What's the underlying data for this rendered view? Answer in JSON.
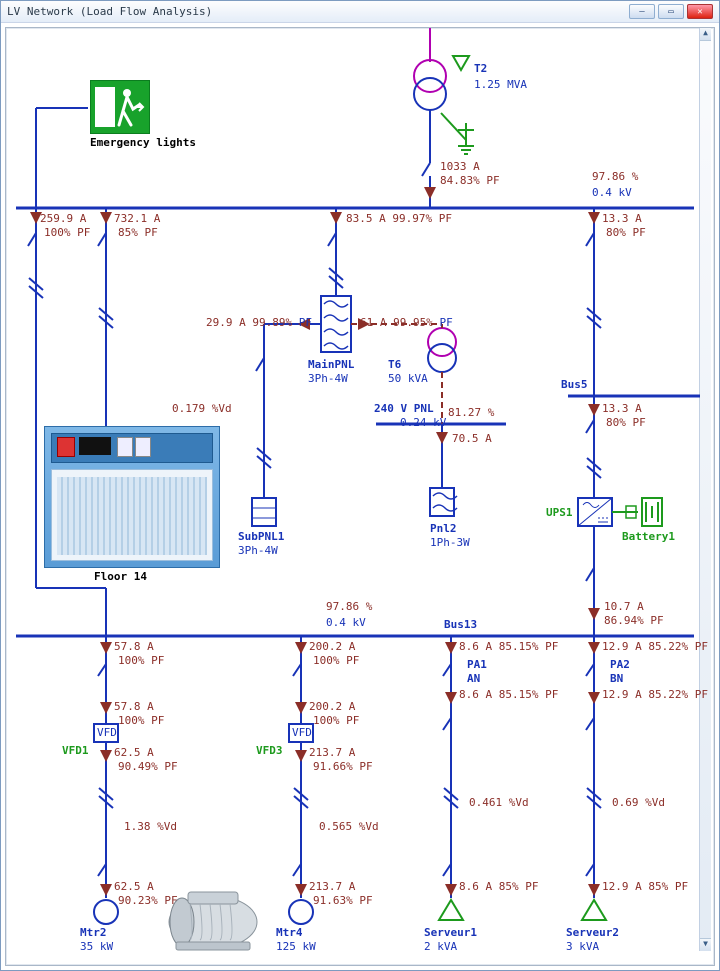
{
  "window": {
    "title": "LV Network (Load Flow Analysis)"
  },
  "labels": {
    "emergency": "Emergency lights",
    "floor14": "Floor 14"
  },
  "source": {
    "T2": {
      "name": "T2",
      "rating": "1.25 MVA"
    }
  },
  "busMain": {
    "voltPct": "97.86 %",
    "voltage": "0.4 kV",
    "incoming": {
      "amps": "1033 A",
      "pf": "84.83% PF"
    }
  },
  "feedersTop": {
    "f1": {
      "amps": "259.9 A",
      "pf": "100% PF",
      "vdrop": "0.179 %Vd"
    },
    "f2": {
      "amps": "732.1 A",
      "pf": "85% PF"
    },
    "f3": {
      "amps": "83.5 A",
      "pf": "99.97% PF"
    },
    "f4": {
      "amps": "13.3 A",
      "pf": "80% PF"
    }
  },
  "panelGroup": {
    "mainpnl": {
      "name": "MainPNL",
      "type": "3Ph-4W",
      "amps": "29.9 A 99.89%",
      "pfWord": "PF"
    },
    "subpnl1": {
      "name": "SubPNL1",
      "type": "3Ph-4W"
    },
    "t6branch": {
      "amps": "61 A 99.95%",
      "pfWord": "PF"
    },
    "T6": {
      "name": "T6",
      "rating": "50 kVA"
    },
    "pnl240": {
      "name": "240 V PNL",
      "voltage": "0.24 kV",
      "pct": "81.27 %",
      "amps": "70.5 A"
    },
    "pnl2": {
      "name": "Pnl2",
      "type": "1Ph-3W"
    }
  },
  "bus5": {
    "name": "Bus5",
    "feed": {
      "amps": "13.3 A",
      "pf": "80% PF"
    },
    "ups": "UPS1",
    "battery": "Battery1"
  },
  "bus13": {
    "name": "Bus13",
    "voltPct": "97.86 %",
    "voltage": "0.4 kV",
    "upsOut": {
      "amps": "10.7 A",
      "pf": "86.94% PF"
    }
  },
  "loads": {
    "mtr2branch": {
      "top": {
        "amps": "57.8 A",
        "pf": "100% PF"
      },
      "mid": {
        "amps": "57.8 A",
        "pf": "100% PF"
      },
      "vfd": "VFD1",
      "vfdOut": {
        "amps": "62.5 A",
        "pf": "90.49% PF"
      },
      "vdrop": "1.38 %Vd",
      "bottom": {
        "amps": "62.5 A",
        "pf": "90.23% PF"
      },
      "name": "Mtr2",
      "rating": "35 kW"
    },
    "mtr4branch": {
      "top": {
        "amps": "200.2 A",
        "pf": "100% PF"
      },
      "mid": {
        "amps": "200.2 A",
        "pf": "100% PF"
      },
      "vfd": "VFD3",
      "vfdOut": {
        "amps": "213.7 A",
        "pf": "91.66% PF"
      },
      "vdrop": "0.565 %Vd",
      "bottom": {
        "amps": "213.7 A",
        "pf": "91.63% PF"
      },
      "name": "Mtr4",
      "rating": "125 kW"
    },
    "serv1branch": {
      "top": {
        "amps": "8.6 A 85.15% PF"
      },
      "pa": "PA1",
      "phase": "AN",
      "mid": {
        "amps": "8.6 A 85.15% PF"
      },
      "vdrop": "0.461 %Vd",
      "bottom": {
        "amps": "8.6 A 85% PF"
      },
      "name": "Serveur1",
      "rating": "2 kVA"
    },
    "serv2branch": {
      "top": {
        "amps": "12.9 A 85.22% PF"
      },
      "pa": "PA2",
      "phase": "BN",
      "mid": {
        "amps": "12.9 A 85.22% PF"
      },
      "vdrop": "0.69 %Vd",
      "bottom": {
        "amps": "12.9 A 85% PF"
      },
      "name": "Serveur2",
      "rating": "3 kVA"
    }
  }
}
